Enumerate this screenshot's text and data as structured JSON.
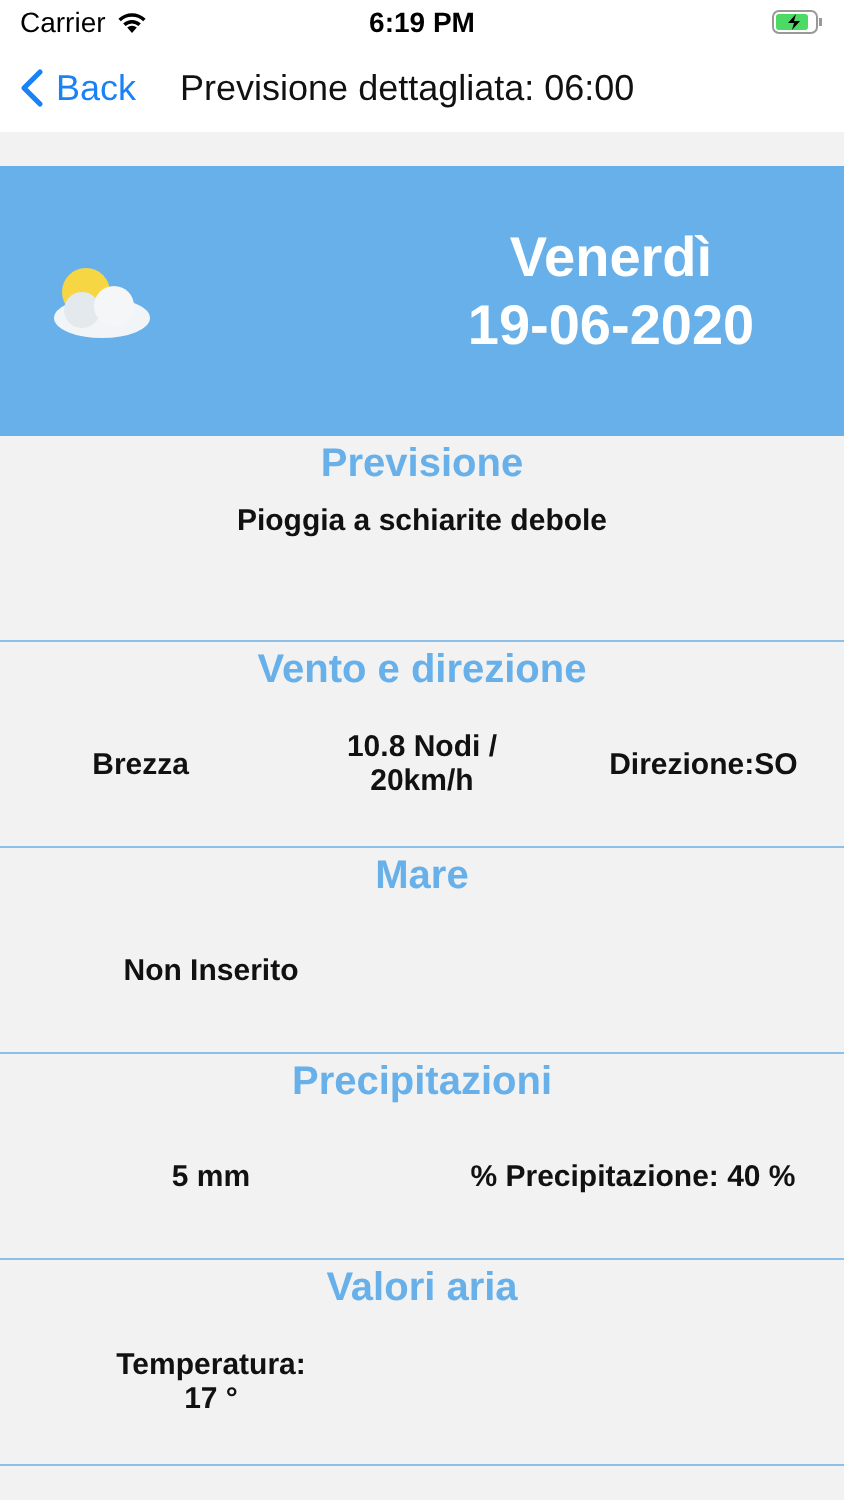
{
  "status_bar": {
    "carrier": "Carrier",
    "time": "6:19 PM"
  },
  "nav": {
    "back": "Back",
    "title": "Previsione dettagliata: 06:00"
  },
  "header": {
    "day": "Venerdì",
    "date": "19-06-2020"
  },
  "sections": [
    {
      "title": "Previsione",
      "kind": "full",
      "items": [
        "Pioggia a schiarite debole"
      ]
    },
    {
      "title": "Vento e direzione",
      "kind": "thirds",
      "items": [
        "Brezza",
        "10.8 Nodi /  20km/h",
        "Direzione:SO"
      ]
    },
    {
      "title": "Mare",
      "kind": "halves",
      "items": [
        "Non Inserito"
      ]
    },
    {
      "title": "Precipitazioni",
      "kind": "halves",
      "items": [
        "5 mm",
        "% Precipitazione: 40 %"
      ]
    },
    {
      "title": "Valori aria",
      "kind": "halves",
      "items": [
        "Temperatura: 17 °"
      ]
    }
  ]
}
